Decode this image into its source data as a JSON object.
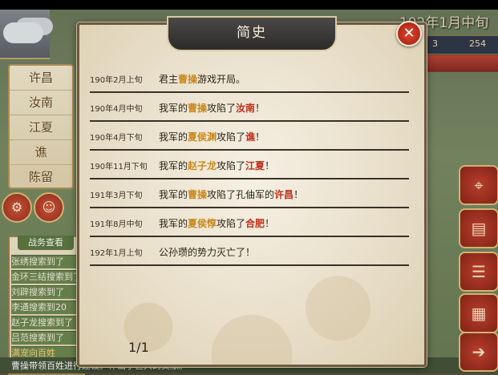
{
  "background": {
    "date_text": "192年1月中旬",
    "resources": [
      "3",
      "254"
    ],
    "cities": [
      "许昌",
      "汝南",
      "江夏",
      "谯",
      "陈留"
    ],
    "log_tab": "战务查看",
    "log_lines": [
      {
        "text": "张绣搜索到了",
        "hl": false
      },
      {
        "text": "金环三结搜索到了",
        "hl": false
      },
      {
        "text": "刘辟搜索到了",
        "hl": false
      },
      {
        "text": "李通搜索到20",
        "hl": false
      },
      {
        "text": "赵子龙搜索到了",
        "hl": false
      },
      {
        "text": "吕范搜索到了",
        "hl": false
      },
      {
        "text": "满宠向百姓",
        "hl": true
      }
    ],
    "bottom_text": "曹操带领百姓进行建设。作出了巨大的贡献。",
    "colors": {
      "accent": "#c9442f",
      "gold": "#c9881a",
      "red": "#c22d1a"
    }
  },
  "modal": {
    "title": "简史",
    "close_icon": "close-icon",
    "page": "1/1",
    "entries": [
      {
        "date": "190年2月上旬",
        "parts": [
          {
            "t": "君主",
            "c": ""
          },
          {
            "t": "曹操",
            "c": "gold"
          },
          {
            "t": "游戏开局。",
            "c": ""
          }
        ]
      },
      {
        "date": "190年4月中旬",
        "parts": [
          {
            "t": "我军的",
            "c": ""
          },
          {
            "t": "曹操",
            "c": "gold"
          },
          {
            "t": "攻陷了",
            "c": ""
          },
          {
            "t": "汝南",
            "c": "red"
          },
          {
            "t": "！",
            "c": ""
          }
        ]
      },
      {
        "date": "190年4月下旬",
        "parts": [
          {
            "t": "我军的",
            "c": ""
          },
          {
            "t": "夏侯渊",
            "c": "gold"
          },
          {
            "t": "攻陷了",
            "c": ""
          },
          {
            "t": "谯",
            "c": "red"
          },
          {
            "t": "！",
            "c": ""
          }
        ]
      },
      {
        "date": "190年11月下旬",
        "parts": [
          {
            "t": "我军的",
            "c": ""
          },
          {
            "t": "赵子龙",
            "c": "gold"
          },
          {
            "t": "攻陷了",
            "c": ""
          },
          {
            "t": "江夏",
            "c": "red"
          },
          {
            "t": "！",
            "c": ""
          }
        ]
      },
      {
        "date": "191年3月下旬",
        "parts": [
          {
            "t": "我军的",
            "c": ""
          },
          {
            "t": "曹操",
            "c": "gold"
          },
          {
            "t": "攻陷了孔伷军的",
            "c": ""
          },
          {
            "t": "许昌",
            "c": "red"
          },
          {
            "t": "！",
            "c": ""
          }
        ]
      },
      {
        "date": "191年8月中旬",
        "parts": [
          {
            "t": "我军的",
            "c": ""
          },
          {
            "t": "夏侯惇",
            "c": "gold"
          },
          {
            "t": "攻陷了",
            "c": ""
          },
          {
            "t": "合肥",
            "c": "red"
          },
          {
            "t": "！",
            "c": ""
          }
        ]
      },
      {
        "date": "192年1月上旬",
        "parts": [
          {
            "t": "公孙瓒的势力灭亡了！",
            "c": ""
          }
        ]
      }
    ]
  }
}
